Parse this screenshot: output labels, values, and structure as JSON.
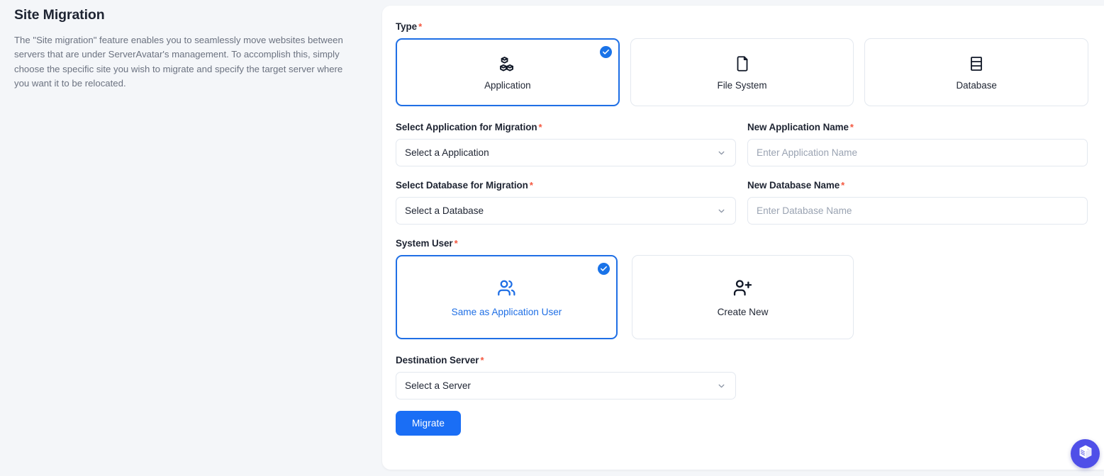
{
  "left_panel": {
    "title": "Site Migration",
    "description": "The \"Site migration\" feature enables you to seamlessly move websites between servers that are under ServerAvatar's management. To accomplish this, simply choose the specific site you wish to migrate and specify the target server where you want it to be relocated."
  },
  "form": {
    "type": {
      "label": "Type",
      "required_mark": "*",
      "options": [
        {
          "label": "Application",
          "icon": "boxes-icon",
          "selected": true
        },
        {
          "label": "File System",
          "icon": "file-icon",
          "selected": false
        },
        {
          "label": "Database",
          "icon": "database-icon",
          "selected": false
        }
      ]
    },
    "select_application": {
      "label": "Select Application for Migration",
      "required_mark": "*",
      "value": "Select a Application"
    },
    "new_application_name": {
      "label": "New Application Name",
      "required_mark": "*",
      "value": "",
      "placeholder": "Enter Application Name"
    },
    "select_database": {
      "label": "Select Database for Migration",
      "required_mark": "*",
      "value": "Select a Database"
    },
    "new_database_name": {
      "label": "New Database Name",
      "required_mark": "*",
      "value": "",
      "placeholder": "Enter Database Name"
    },
    "system_user": {
      "label": "System User",
      "required_mark": "*",
      "options": [
        {
          "label": "Same as Application User",
          "icon": "users-icon",
          "selected": true
        },
        {
          "label": "Create New",
          "icon": "user-plus-icon",
          "selected": false
        }
      ]
    },
    "destination_server": {
      "label": "Destination Server",
      "required_mark": "*",
      "value": "Select a Server"
    },
    "submit": {
      "label": "Migrate"
    }
  },
  "fab": {
    "icon": "cube-logo-icon"
  },
  "colors": {
    "accent_blue": "#1a6ef5",
    "selected_border": "#1f6fe5",
    "required_red": "#f4573f",
    "page_background": "#f4f6f9",
    "card_background": "#ffffff",
    "fab_background": "#4f4fe8",
    "muted_text": "#6b7280",
    "placeholder_text": "#9aa3b2"
  }
}
